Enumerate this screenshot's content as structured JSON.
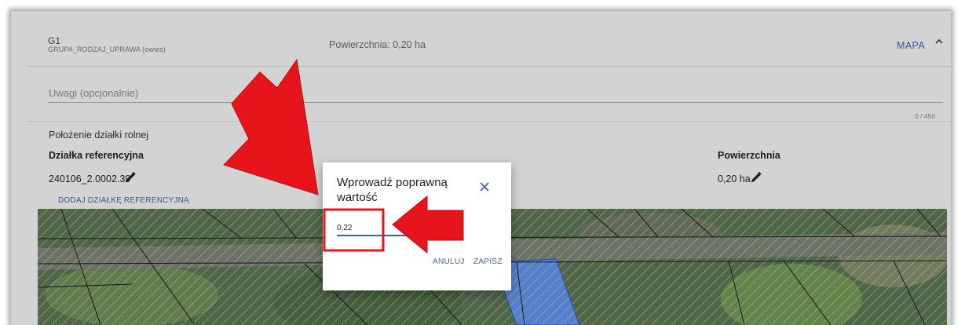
{
  "header": {
    "group_code": "G1",
    "group_sub": "GRUPA_RODZAJ_UPRAWA (owies)",
    "area_text": "Powierzchnia: 0,20 ha",
    "map_label": "MAPA",
    "chevron_icon": "chevron-up-icon"
  },
  "remarks": {
    "placeholder": "Uwagi (opcjonalnie)",
    "counter": "0 / 450"
  },
  "location": {
    "title": "Położenie działki rolnej",
    "col_reference": "Działka referencyjna",
    "col_area": "Powierzchnia",
    "reference_value": "240106_2.0002.39",
    "area_value": "0,20 ha",
    "edit_icon": "pencil-icon",
    "add_reference_label": "DODAJ DZIAŁKĘ REFERENCYJNĄ"
  },
  "dialog": {
    "title": "Wprowadź poprawną wartość",
    "input_value": "0,22",
    "close_icon": "close-icon",
    "cancel_label": "ANULUJ",
    "save_label": "ZAPISZ"
  },
  "colors": {
    "accent": "#3f5fa8",
    "annotation_red": "#e8141b",
    "map_highlight": "#5f8ee0"
  }
}
